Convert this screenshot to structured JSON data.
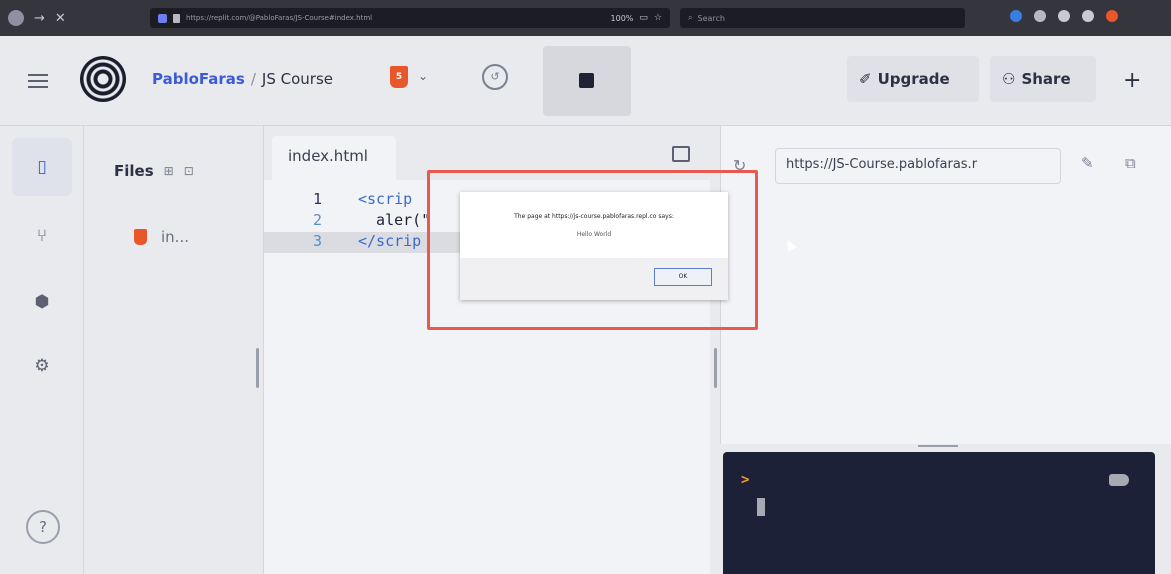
{
  "browser": {
    "url": "https://replit.com/@PabloFaras/JS-Course#index.html",
    "zoom": "100%",
    "search_placeholder": "Search"
  },
  "header": {
    "username": "PabloFaras",
    "separator": "/",
    "project": "JS Course",
    "upgrade_label": "Upgrade",
    "share_label": "Share"
  },
  "sidebar": {
    "help_label": "?"
  },
  "files": {
    "title": "Files",
    "items": [
      {
        "name": "in..."
      }
    ]
  },
  "editor": {
    "tab_label": "index.html",
    "lines": [
      {
        "num": "1",
        "text": "<scrip"
      },
      {
        "num": "2",
        "text": "  aler(\""
      },
      {
        "num": "3",
        "text": "</scrip"
      }
    ]
  },
  "preview": {
    "url": "https://JS-Course.pablofaras.r"
  },
  "console": {
    "prompt": ">"
  },
  "dialog": {
    "message": "The page at https://js-course.pablofaras.repl.co says:",
    "text": "Hello World",
    "ok_label": "OK"
  },
  "colors": {
    "accent": "#3b5bd9",
    "html5": "#e8562a",
    "highlight": "#e85a4f",
    "console_bg": "#1d2138"
  }
}
